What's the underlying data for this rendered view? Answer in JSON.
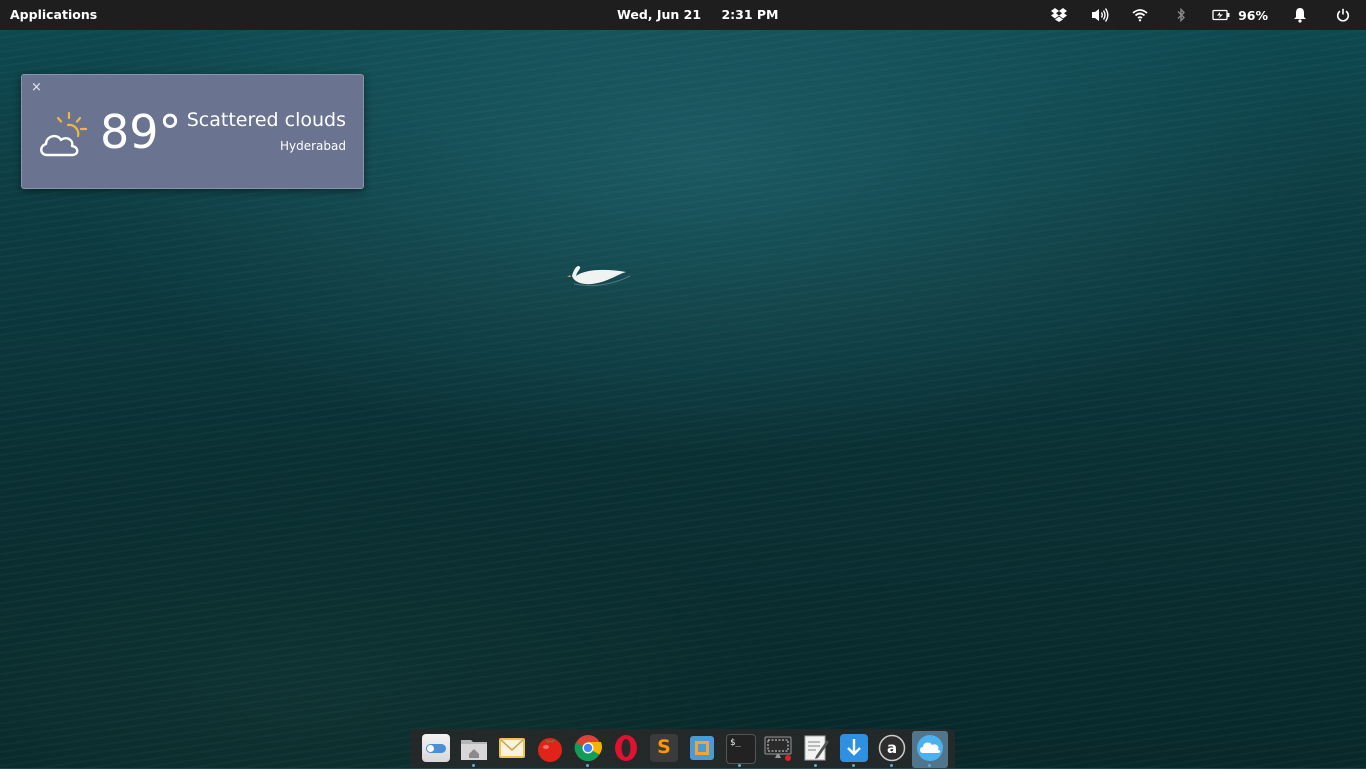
{
  "panel": {
    "applications": "Applications",
    "date": "Wed, Jun 21",
    "time": "2:31 PM",
    "battery_percent": "96%"
  },
  "weather": {
    "close": "×",
    "temperature": "89°",
    "condition": "Scattered clouds",
    "city": "Hyderabad"
  },
  "dock": {
    "apps": [
      "settings",
      "files",
      "mail",
      "tomato",
      "chrome",
      "opera",
      "sublime-text",
      "virtualbox",
      "terminal",
      "screen-recorder",
      "text-editor",
      "downloads",
      "amazon",
      "weather"
    ]
  }
}
